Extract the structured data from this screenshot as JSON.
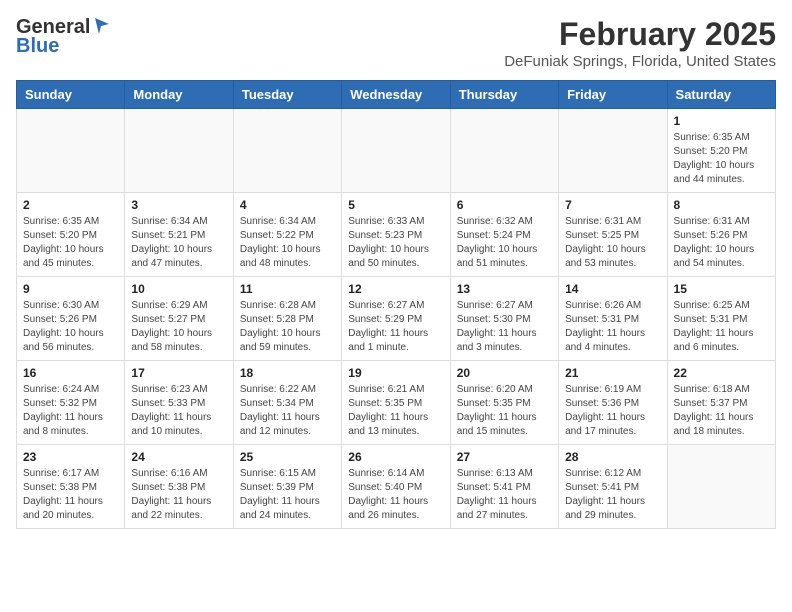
{
  "header": {
    "logo_line1": "General",
    "logo_line2": "Blue",
    "main_title": "February 2025",
    "subtitle": "DeFuniak Springs, Florida, United States"
  },
  "days_of_week": [
    "Sunday",
    "Monday",
    "Tuesday",
    "Wednesday",
    "Thursday",
    "Friday",
    "Saturday"
  ],
  "weeks": [
    [
      {
        "day": "",
        "info": ""
      },
      {
        "day": "",
        "info": ""
      },
      {
        "day": "",
        "info": ""
      },
      {
        "day": "",
        "info": ""
      },
      {
        "day": "",
        "info": ""
      },
      {
        "day": "",
        "info": ""
      },
      {
        "day": "1",
        "info": "Sunrise: 6:35 AM\nSunset: 5:20 PM\nDaylight: 10 hours\nand 44 minutes."
      }
    ],
    [
      {
        "day": "2",
        "info": "Sunrise: 6:35 AM\nSunset: 5:20 PM\nDaylight: 10 hours\nand 45 minutes."
      },
      {
        "day": "3",
        "info": "Sunrise: 6:34 AM\nSunset: 5:21 PM\nDaylight: 10 hours\nand 47 minutes."
      },
      {
        "day": "4",
        "info": "Sunrise: 6:34 AM\nSunset: 5:22 PM\nDaylight: 10 hours\nand 48 minutes."
      },
      {
        "day": "5",
        "info": "Sunrise: 6:33 AM\nSunset: 5:23 PM\nDaylight: 10 hours\nand 50 minutes."
      },
      {
        "day": "6",
        "info": "Sunrise: 6:32 AM\nSunset: 5:24 PM\nDaylight: 10 hours\nand 51 minutes."
      },
      {
        "day": "7",
        "info": "Sunrise: 6:31 AM\nSunset: 5:25 PM\nDaylight: 10 hours\nand 53 minutes."
      },
      {
        "day": "8",
        "info": "Sunrise: 6:31 AM\nSunset: 5:26 PM\nDaylight: 10 hours\nand 54 minutes."
      }
    ],
    [
      {
        "day": "9",
        "info": "Sunrise: 6:30 AM\nSunset: 5:26 PM\nDaylight: 10 hours\nand 56 minutes."
      },
      {
        "day": "10",
        "info": "Sunrise: 6:29 AM\nSunset: 5:27 PM\nDaylight: 10 hours\nand 58 minutes."
      },
      {
        "day": "11",
        "info": "Sunrise: 6:28 AM\nSunset: 5:28 PM\nDaylight: 10 hours\nand 59 minutes."
      },
      {
        "day": "12",
        "info": "Sunrise: 6:27 AM\nSunset: 5:29 PM\nDaylight: 11 hours\nand 1 minute."
      },
      {
        "day": "13",
        "info": "Sunrise: 6:27 AM\nSunset: 5:30 PM\nDaylight: 11 hours\nand 3 minutes."
      },
      {
        "day": "14",
        "info": "Sunrise: 6:26 AM\nSunset: 5:31 PM\nDaylight: 11 hours\nand 4 minutes."
      },
      {
        "day": "15",
        "info": "Sunrise: 6:25 AM\nSunset: 5:31 PM\nDaylight: 11 hours\nand 6 minutes."
      }
    ],
    [
      {
        "day": "16",
        "info": "Sunrise: 6:24 AM\nSunset: 5:32 PM\nDaylight: 11 hours\nand 8 minutes."
      },
      {
        "day": "17",
        "info": "Sunrise: 6:23 AM\nSunset: 5:33 PM\nDaylight: 11 hours\nand 10 minutes."
      },
      {
        "day": "18",
        "info": "Sunrise: 6:22 AM\nSunset: 5:34 PM\nDaylight: 11 hours\nand 12 minutes."
      },
      {
        "day": "19",
        "info": "Sunrise: 6:21 AM\nSunset: 5:35 PM\nDaylight: 11 hours\nand 13 minutes."
      },
      {
        "day": "20",
        "info": "Sunrise: 6:20 AM\nSunset: 5:35 PM\nDaylight: 11 hours\nand 15 minutes."
      },
      {
        "day": "21",
        "info": "Sunrise: 6:19 AM\nSunset: 5:36 PM\nDaylight: 11 hours\nand 17 minutes."
      },
      {
        "day": "22",
        "info": "Sunrise: 6:18 AM\nSunset: 5:37 PM\nDaylight: 11 hours\nand 18 minutes."
      }
    ],
    [
      {
        "day": "23",
        "info": "Sunrise: 6:17 AM\nSunset: 5:38 PM\nDaylight: 11 hours\nand 20 minutes."
      },
      {
        "day": "24",
        "info": "Sunrise: 6:16 AM\nSunset: 5:38 PM\nDaylight: 11 hours\nand 22 minutes."
      },
      {
        "day": "25",
        "info": "Sunrise: 6:15 AM\nSunset: 5:39 PM\nDaylight: 11 hours\nand 24 minutes."
      },
      {
        "day": "26",
        "info": "Sunrise: 6:14 AM\nSunset: 5:40 PM\nDaylight: 11 hours\nand 26 minutes."
      },
      {
        "day": "27",
        "info": "Sunrise: 6:13 AM\nSunset: 5:41 PM\nDaylight: 11 hours\nand 27 minutes."
      },
      {
        "day": "28",
        "info": "Sunrise: 6:12 AM\nSunset: 5:41 PM\nDaylight: 11 hours\nand 29 minutes."
      },
      {
        "day": "",
        "info": ""
      }
    ]
  ]
}
